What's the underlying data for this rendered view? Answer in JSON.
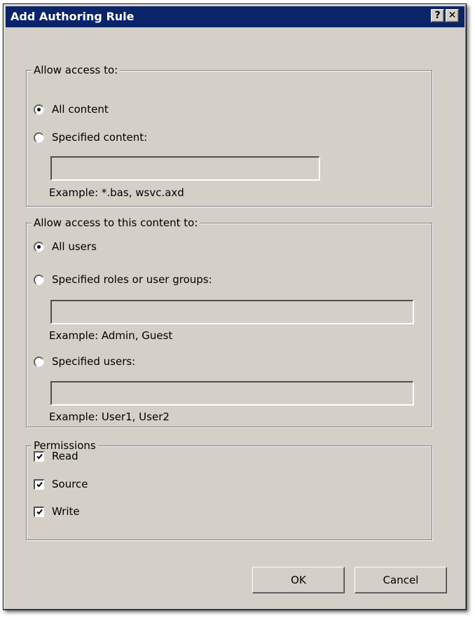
{
  "window": {
    "title": "Add Authoring Rule",
    "help_label": "?",
    "close_label": "✕"
  },
  "allow_access": {
    "legend": "Allow access to:",
    "options": [
      {
        "label": "All content",
        "selected": true
      },
      {
        "label": "Specified content:",
        "selected": false
      }
    ],
    "content_value": "",
    "example": "Example: *.bas, wsvc.axd"
  },
  "allow_users": {
    "legend": "Allow access to this content to:",
    "options": [
      {
        "label": "All users",
        "selected": true
      },
      {
        "label": "Specified roles or user groups:",
        "selected": false
      },
      {
        "label": "Specified users:",
        "selected": false
      }
    ],
    "roles_value": "",
    "roles_example": "Example: Admin, Guest",
    "users_value": "",
    "users_example": "Example: User1, User2"
  },
  "permissions": {
    "legend": "Permissions",
    "items": [
      {
        "label": "Read",
        "checked": true
      },
      {
        "label": "Source",
        "checked": true
      },
      {
        "label": "Write",
        "checked": true
      }
    ]
  },
  "buttons": {
    "ok": "OK",
    "cancel": "Cancel"
  },
  "colors": {
    "titlebar": "#0a246a",
    "dialog_face": "#d4d0c8"
  }
}
